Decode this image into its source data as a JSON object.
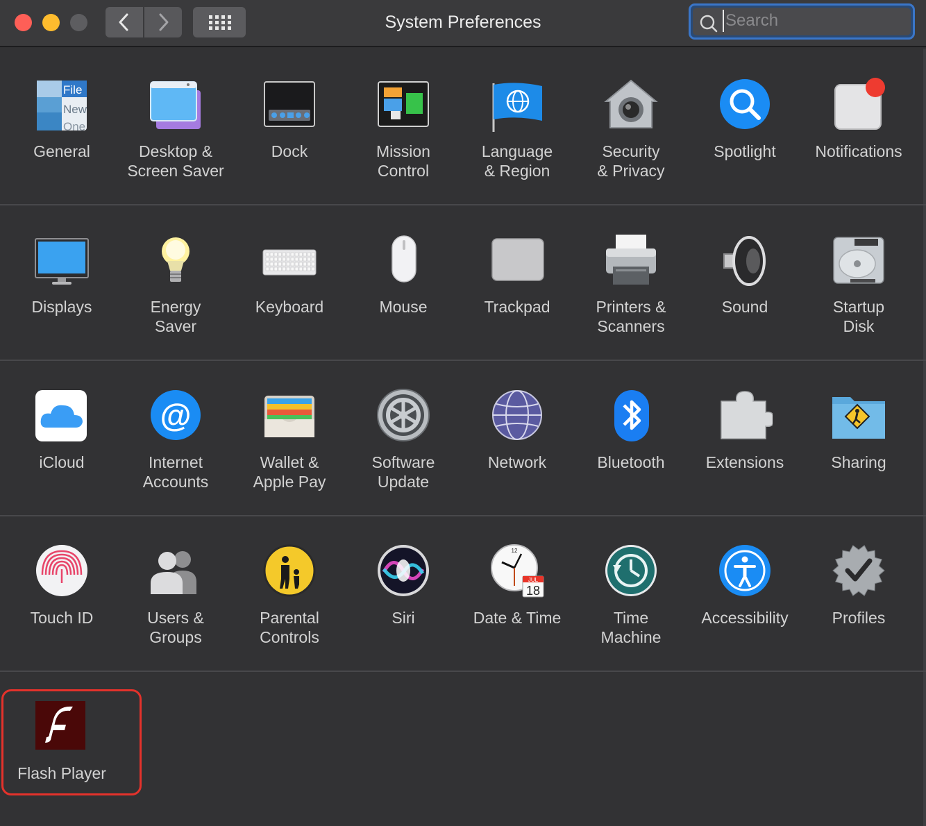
{
  "window": {
    "title": "System Preferences"
  },
  "search": {
    "placeholder": "Search"
  },
  "rows": [
    [
      {
        "label": "General",
        "icon": "general-icon"
      },
      {
        "label": "Desktop & Screen Saver",
        "icon": "desktop-screen-saver-icon"
      },
      {
        "label": "Dock",
        "icon": "dock-icon"
      },
      {
        "label": "Mission Control",
        "icon": "mission-control-icon"
      },
      {
        "label": "Language & Region",
        "icon": "language-region-icon"
      },
      {
        "label": "Security & Privacy",
        "icon": "security-privacy-icon"
      },
      {
        "label": "Spotlight",
        "icon": "spotlight-icon"
      },
      {
        "label": "Notifications",
        "icon": "notifications-icon"
      }
    ],
    [
      {
        "label": "Displays",
        "icon": "displays-icon"
      },
      {
        "label": "Energy Saver",
        "icon": "energy-saver-icon"
      },
      {
        "label": "Keyboard",
        "icon": "keyboard-icon"
      },
      {
        "label": "Mouse",
        "icon": "mouse-icon"
      },
      {
        "label": "Trackpad",
        "icon": "trackpad-icon"
      },
      {
        "label": "Printers & Scanners",
        "icon": "printers-scanners-icon"
      },
      {
        "label": "Sound",
        "icon": "sound-icon"
      },
      {
        "label": "Startup Disk",
        "icon": "startup-disk-icon"
      }
    ],
    [
      {
        "label": "iCloud",
        "icon": "icloud-icon"
      },
      {
        "label": "Internet Accounts",
        "icon": "internet-accounts-icon"
      },
      {
        "label": "Wallet & Apple Pay",
        "icon": "wallet-apple-pay-icon"
      },
      {
        "label": "Software Update",
        "icon": "software-update-icon"
      },
      {
        "label": "Network",
        "icon": "network-icon"
      },
      {
        "label": "Bluetooth",
        "icon": "bluetooth-icon"
      },
      {
        "label": "Extensions",
        "icon": "extensions-icon"
      },
      {
        "label": "Sharing",
        "icon": "sharing-icon"
      }
    ],
    [
      {
        "label": "Touch ID",
        "icon": "touch-id-icon"
      },
      {
        "label": "Users & Groups",
        "icon": "users-groups-icon"
      },
      {
        "label": "Parental Controls",
        "icon": "parental-controls-icon"
      },
      {
        "label": "Siri",
        "icon": "siri-icon"
      },
      {
        "label": "Date & Time",
        "icon": "date-time-icon"
      },
      {
        "label": "Time Machine",
        "icon": "time-machine-icon"
      },
      {
        "label": "Accessibility",
        "icon": "accessibility-icon"
      },
      {
        "label": "Profiles",
        "icon": "profiles-icon"
      }
    ],
    [
      {
        "label": "Flash Player",
        "icon": "flash-player-icon"
      }
    ]
  ],
  "icon_text": {
    "general_file": "File",
    "general_new": "New",
    "general_one": "One",
    "calendar_month": "JUL",
    "calendar_day": "18",
    "clock_12": "12"
  },
  "colors": {
    "accent": "#3a76c9",
    "highlight": "#e4322b"
  }
}
